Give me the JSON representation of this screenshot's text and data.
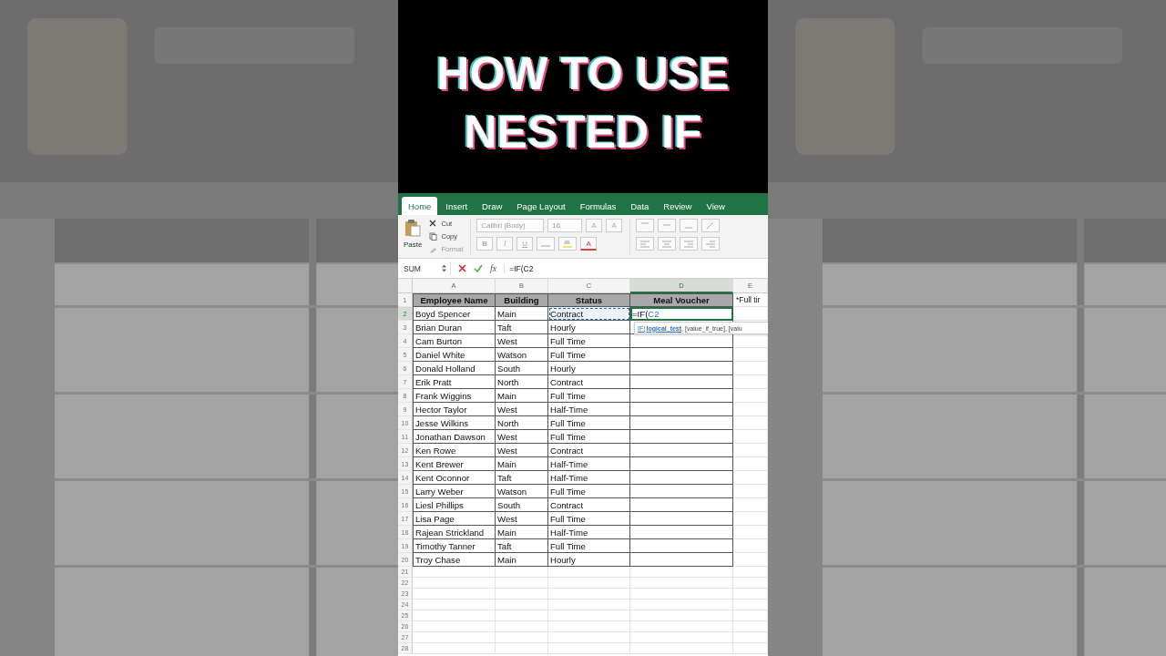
{
  "title": "HOW TO USE NESTED IF",
  "ribbon_tabs": [
    {
      "label": "Home",
      "selected": true
    },
    {
      "label": "Insert",
      "selected": false
    },
    {
      "label": "Draw",
      "selected": false
    },
    {
      "label": "Page Layout",
      "selected": false
    },
    {
      "label": "Formulas",
      "selected": false
    },
    {
      "label": "Data",
      "selected": false
    },
    {
      "label": "Review",
      "selected": false
    },
    {
      "label": "View",
      "selected": false
    }
  ],
  "clipboard": {
    "paste": "Paste",
    "cut": "Cut",
    "copy": "Copy",
    "format": "Format"
  },
  "font": {
    "name": "Calibri (Body)",
    "size": "16",
    "grow": "A",
    "shrink": "A",
    "bold": "B",
    "italic": "I",
    "underline": "U",
    "font_color_label": "A"
  },
  "formula_bar": {
    "name_box": "SUM",
    "fx": "fx",
    "formula": "=IF(C2"
  },
  "columns": [
    {
      "letter": "A",
      "selected": false
    },
    {
      "letter": "B",
      "selected": false
    },
    {
      "letter": "C",
      "selected": false
    },
    {
      "letter": "D",
      "selected": true
    },
    {
      "letter": "E",
      "selected": false
    }
  ],
  "rows": [
    {
      "number": "1",
      "selected": false,
      "cells": [
        {
          "kind": "header",
          "text": "Employee Name"
        },
        {
          "kind": "header",
          "text": "Building"
        },
        {
          "kind": "header",
          "text": "Status"
        },
        {
          "kind": "header",
          "text": "Meal Voucher"
        },
        {
          "kind": "note",
          "text": "*Full tir"
        }
      ]
    },
    {
      "number": "2",
      "selected": true,
      "cells": [
        {
          "kind": "text",
          "text": "Boyd Spencer"
        },
        {
          "kind": "text",
          "text": "Main"
        },
        {
          "kind": "marquee",
          "text": "Contract"
        },
        {
          "kind": "editing",
          "text": "=IF(",
          "ref": "C2"
        },
        {
          "kind": "none"
        }
      ]
    },
    {
      "number": "3",
      "selected": false,
      "cells": [
        {
          "kind": "text",
          "text": "Brian Duran"
        },
        {
          "kind": "text",
          "text": "Taft"
        },
        {
          "kind": "text",
          "text": "Hourly"
        },
        {
          "kind": "blank"
        },
        {
          "kind": "none"
        }
      ]
    },
    {
      "number": "4",
      "selected": false,
      "cells": [
        {
          "kind": "text",
          "text": "Cam Burton"
        },
        {
          "kind": "text",
          "text": "West"
        },
        {
          "kind": "text",
          "text": "Full Time"
        },
        {
          "kind": "blank"
        },
        {
          "kind": "none"
        }
      ]
    },
    {
      "number": "5",
      "selected": false,
      "cells": [
        {
          "kind": "text",
          "text": "Daniel White"
        },
        {
          "kind": "text",
          "text": "Watson"
        },
        {
          "kind": "text",
          "text": "Full Time"
        },
        {
          "kind": "blank"
        },
        {
          "kind": "none"
        }
      ]
    },
    {
      "number": "6",
      "selected": false,
      "cells": [
        {
          "kind": "text",
          "text": "Donald Holland"
        },
        {
          "kind": "text",
          "text": "South"
        },
        {
          "kind": "text",
          "text": "Hourly"
        },
        {
          "kind": "blank"
        },
        {
          "kind": "none"
        }
      ]
    },
    {
      "number": "7",
      "selected": false,
      "cells": [
        {
          "kind": "text",
          "text": "Erik Pratt"
        },
        {
          "kind": "text",
          "text": "North"
        },
        {
          "kind": "text",
          "text": "Contract"
        },
        {
          "kind": "blank"
        },
        {
          "kind": "none"
        }
      ]
    },
    {
      "number": "8",
      "selected": false,
      "cells": [
        {
          "kind": "text",
          "text": "Frank Wiggins"
        },
        {
          "kind": "text",
          "text": "Main"
        },
        {
          "kind": "text",
          "text": "Full Time"
        },
        {
          "kind": "blank"
        },
        {
          "kind": "none"
        }
      ]
    },
    {
      "number": "9",
      "selected": false,
      "cells": [
        {
          "kind": "text",
          "text": "Hector Taylor"
        },
        {
          "kind": "text",
          "text": "West"
        },
        {
          "kind": "text",
          "text": "Half-Time"
        },
        {
          "kind": "blank"
        },
        {
          "kind": "none"
        }
      ]
    },
    {
      "number": "10",
      "selected": false,
      "cells": [
        {
          "kind": "text",
          "text": "Jesse Wilkins"
        },
        {
          "kind": "text",
          "text": "North"
        },
        {
          "kind": "text",
          "text": "Full Time"
        },
        {
          "kind": "blank"
        },
        {
          "kind": "none"
        }
      ]
    },
    {
      "number": "11",
      "selected": false,
      "cells": [
        {
          "kind": "text",
          "text": "Jonathan Dawson"
        },
        {
          "kind": "text",
          "text": "West"
        },
        {
          "kind": "text",
          "text": "Full Time"
        },
        {
          "kind": "blank"
        },
        {
          "kind": "none"
        }
      ]
    },
    {
      "number": "12",
      "selected": false,
      "cells": [
        {
          "kind": "text",
          "text": "Ken Rowe"
        },
        {
          "kind": "text",
          "text": "West"
        },
        {
          "kind": "text",
          "text": "Contract"
        },
        {
          "kind": "blank"
        },
        {
          "kind": "none"
        }
      ]
    },
    {
      "number": "13",
      "selected": false,
      "cells": [
        {
          "kind": "text",
          "text": "Kent Brewer"
        },
        {
          "kind": "text",
          "text": "Main"
        },
        {
          "kind": "text",
          "text": "Half-Time"
        },
        {
          "kind": "blank"
        },
        {
          "kind": "none"
        }
      ]
    },
    {
      "number": "14",
      "selected": false,
      "cells": [
        {
          "kind": "text",
          "text": "Kent Oconnor"
        },
        {
          "kind": "text",
          "text": "Taft"
        },
        {
          "kind": "text",
          "text": "Half-Time"
        },
        {
          "kind": "blank"
        },
        {
          "kind": "none"
        }
      ]
    },
    {
      "number": "15",
      "selected": false,
      "cells": [
        {
          "kind": "text",
          "text": "Larry Weber"
        },
        {
          "kind": "text",
          "text": "Watson"
        },
        {
          "kind": "text",
          "text": "Full Time"
        },
        {
          "kind": "blank"
        },
        {
          "kind": "none"
        }
      ]
    },
    {
      "number": "16",
      "selected": false,
      "cells": [
        {
          "kind": "text",
          "text": "Liesl Phillips"
        },
        {
          "kind": "text",
          "text": "South"
        },
        {
          "kind": "text",
          "text": "Contract"
        },
        {
          "kind": "blank"
        },
        {
          "kind": "none"
        }
      ]
    },
    {
      "number": "17",
      "selected": false,
      "cells": [
        {
          "kind": "text",
          "text": "Lisa Page"
        },
        {
          "kind": "text",
          "text": "West"
        },
        {
          "kind": "text",
          "text": "Full Time"
        },
        {
          "kind": "blank"
        },
        {
          "kind": "none"
        }
      ]
    },
    {
      "number": "18",
      "selected": false,
      "cells": [
        {
          "kind": "text",
          "text": "Rajean Strickland"
        },
        {
          "kind": "text",
          "text": "Main"
        },
        {
          "kind": "text",
          "text": "Half-Time"
        },
        {
          "kind": "blank"
        },
        {
          "kind": "none"
        }
      ]
    },
    {
      "number": "19",
      "selected": false,
      "cells": [
        {
          "kind": "text",
          "text": "Timothy Tanner"
        },
        {
          "kind": "text",
          "text": "Taft"
        },
        {
          "kind": "text",
          "text": "Full Time"
        },
        {
          "kind": "blank"
        },
        {
          "kind": "none"
        }
      ]
    },
    {
      "number": "20",
      "selected": false,
      "cells": [
        {
          "kind": "text",
          "text": "Troy Chase"
        },
        {
          "kind": "text",
          "text": "Main"
        },
        {
          "kind": "text",
          "text": "Hourly"
        },
        {
          "kind": "blank"
        },
        {
          "kind": "none"
        }
      ]
    },
    {
      "number": "21",
      "selected": false
    },
    {
      "number": "22",
      "selected": false
    },
    {
      "number": "23",
      "selected": false
    },
    {
      "number": "24",
      "selected": false
    },
    {
      "number": "25",
      "selected": false
    },
    {
      "number": "26",
      "selected": false
    },
    {
      "number": "27",
      "selected": false
    },
    {
      "number": "28",
      "selected": false
    }
  ],
  "tooltip": {
    "function": "IF(",
    "text": "**logical_test**, [value_if_true], [valu"
  }
}
